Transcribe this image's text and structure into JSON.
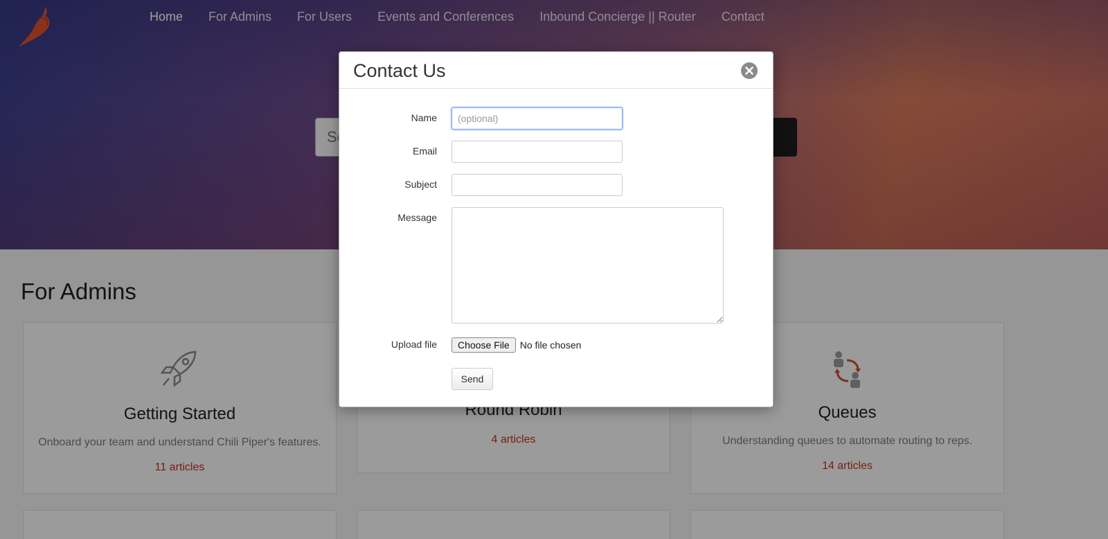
{
  "nav": {
    "items": [
      {
        "label": "Home"
      },
      {
        "label": "For Admins"
      },
      {
        "label": "For Users"
      },
      {
        "label": "Events and Conferences"
      },
      {
        "label": "Inbound Concierge || Router"
      },
      {
        "label": "Contact"
      }
    ]
  },
  "search": {
    "placeholder": "Se"
  },
  "section": {
    "title": "For Admins"
  },
  "cards": [
    {
      "title": "Getting Started",
      "desc": "Onboard your team and understand Chili Piper's features.",
      "count": "11 articles",
      "icon": "rocket-icon"
    },
    {
      "title": "Round Robin",
      "desc": "",
      "count": "4 articles",
      "icon": "round-robin-icon"
    },
    {
      "title": "Queues",
      "desc": "Understanding queues to automate routing to reps.",
      "count": "14 articles",
      "icon": "queues-icon"
    }
  ],
  "modal": {
    "title": "Contact Us",
    "name_label": "Name",
    "name_placeholder": "(optional)",
    "email_label": "Email",
    "subject_label": "Subject",
    "message_label": "Message",
    "upload_label": "Upload file",
    "choose_file_label": "Choose File",
    "no_file_text": "No file chosen",
    "send_label": "Send"
  },
  "colors": {
    "accent": "#c0311b",
    "brand_orange": "#e0522a"
  }
}
